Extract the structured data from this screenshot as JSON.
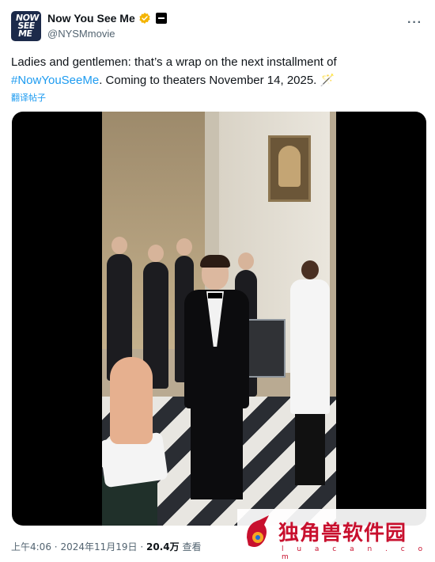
{
  "account": {
    "display_name": "Now You See Me",
    "handle": "@NYSMmovie",
    "avatar_text": "NOW SEE ME",
    "verified_icon": "gold-verified-badge",
    "affiliate_icon": "square-badge-icon"
  },
  "menu": {
    "more_label": "···"
  },
  "tweet": {
    "text_part1": "Ladies and gentlemen: that’s a wrap on the next installment of",
    "hashtag": "#NowYouSeeMe",
    "text_part2": ". Coming to theaters November 14, 2025. ",
    "emoji": "🪄",
    "translate_label": "翻译帖子"
  },
  "meta": {
    "time": "上午4:06",
    "date": "2024年11月19日",
    "views_count": "20.4万",
    "views_label": "查看",
    "separator": "·"
  },
  "watermark": {
    "text": "独角兽软件园",
    "url": "l u a c a n . c o m"
  },
  "colors": {
    "accent": "#1d9bf0",
    "text": "#0f1419",
    "secondary": "#536471",
    "verified": "#f4b400",
    "watermark": "#c8102e"
  }
}
